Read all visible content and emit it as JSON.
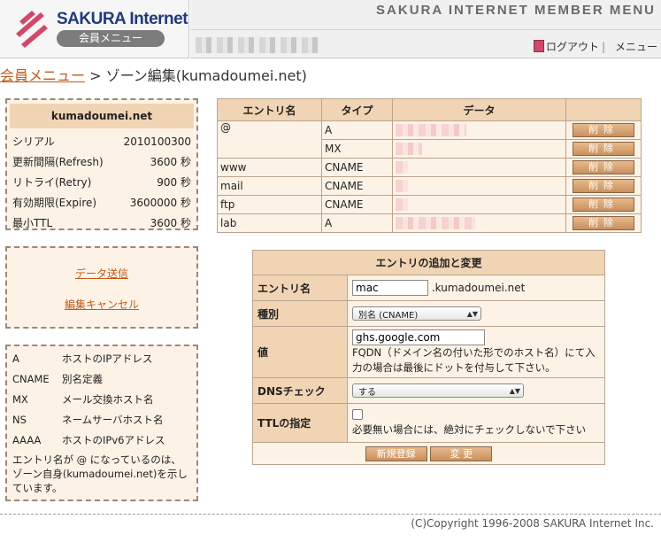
{
  "header": {
    "logo_title": "SAKURA Internet",
    "logo_sub": "会員メニュー",
    "title": "SAKURA INTERNET MEMBER MENU",
    "logout": "ログアウト",
    "separator": "|",
    "menu": "メニュー"
  },
  "breadcrumb": {
    "link": "会員メニュー",
    "separator": ">",
    "current": "ゾーン編集(kumadoumei.net)"
  },
  "zone": {
    "name": "kumadoumei.net",
    "rows": [
      {
        "label": "シリアル",
        "value": "2010100300"
      },
      {
        "label": "更新間隔(Refresh)",
        "value": "3600 秒"
      },
      {
        "label": "リトライ(Retry)",
        "value": "900 秒"
      },
      {
        "label": "有効期限(Expire)",
        "value": "3600000 秒"
      },
      {
        "label": "最小TTL",
        "value": "3600 秒"
      }
    ]
  },
  "actions": {
    "send": "データ送信",
    "cancel": "編集キャンセル"
  },
  "help": {
    "types": [
      {
        "type": "A",
        "desc": "ホストのIPアドレス"
      },
      {
        "type": "CNAME",
        "desc": "別名定義"
      },
      {
        "type": "MX",
        "desc": "メール交換ホスト名"
      },
      {
        "type": "NS",
        "desc": "ネームサーバホスト名"
      },
      {
        "type": "AAAA",
        "desc": "ホストのIPv6アドレス"
      }
    ],
    "note": "エントリ名が @ になっているのは、ゾーン自身(kumadoumei.net)を示しています。"
  },
  "records": {
    "columns": [
      "エントリ名",
      "タイプ",
      "データ",
      ""
    ],
    "delete_label": "削除",
    "rows": [
      {
        "entry": "@",
        "type": "A"
      },
      {
        "entry": "",
        "type": "MX"
      },
      {
        "entry": "www",
        "type": "CNAME"
      },
      {
        "entry": "mail",
        "type": "CNAME"
      },
      {
        "entry": "ftp",
        "type": "CNAME"
      },
      {
        "entry": "lab",
        "type": "A"
      }
    ]
  },
  "form": {
    "title": "エントリの追加と変更",
    "entry_label": "エントリ名",
    "entry_value": "mac",
    "entry_suffix": ".kumadoumei.net",
    "kind_label": "種別",
    "kind_value": "別名 (CNAME)",
    "value_label": "値",
    "value_value": "ghs.google.com",
    "value_note": "FQDN（ドメイン名の付いた形でのホスト名）にて入力の場合は最後にドットを付与して下さい。",
    "dns_label": "DNSチェック",
    "dns_value": "する",
    "ttl_label": "TTLの指定",
    "ttl_note": "必要無い場合には、絶対にチェックしないで下さい",
    "new_button": "新規登録",
    "change_button": "変 更"
  },
  "footer": {
    "copyright": "(C)Copyright 1996-2008 SAKURA Internet Inc."
  },
  "colors": {
    "accent_link": "#c05a1a",
    "panel_bg": "#fdf2e6",
    "header_bg": "#f1d4b4",
    "logo_red": "#d0486a"
  }
}
